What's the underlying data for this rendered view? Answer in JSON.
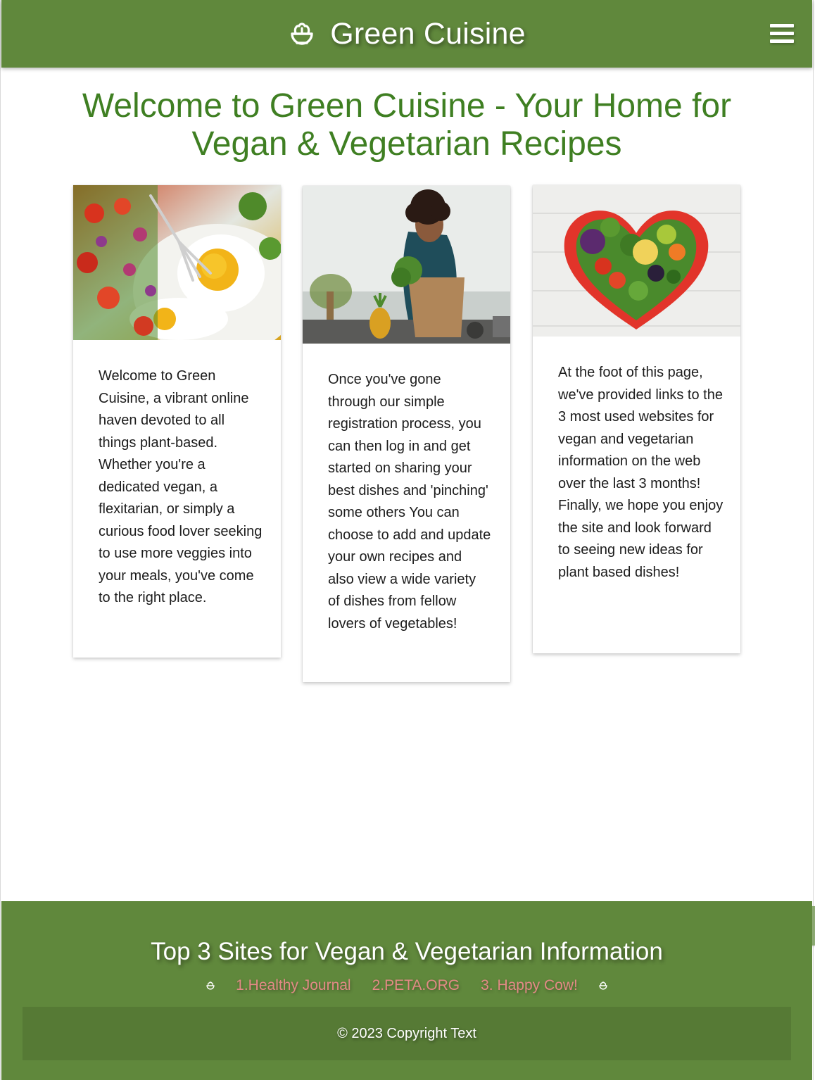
{
  "header": {
    "brand_text": "Green Cuisine",
    "brand_icon": "salad-bowl-icon",
    "menu_icon": "hamburger-menu-icon",
    "background_color": "#60883c"
  },
  "main": {
    "title": "Welcome to Green Cuisine - Your Home for Vegan & Vegetarian Recipes",
    "title_color": "#3f7f22",
    "cards": [
      {
        "image": "vegetables-and-eggs-photo",
        "text": "Welcome to Green Cuisine, a vibrant online haven devoted to all things plant-based. Whether you're a dedicated vegan, a flexitarian, or simply a curious food lover seeking to use more veggies into your meals, you've come to the right place."
      },
      {
        "image": "woman-unpacking-groceries-photo",
        "text": "Once you've gone through our simple registration process, you can then log in and get started on sharing your best dishes and 'pinching' some others You can choose to add and update your own recipes and also view a wide variety of dishes from fellow lovers of vegetables!"
      },
      {
        "image": "heart-shaped-vegetable-plate-photo",
        "text_lines": [
          "At the foot of this page, we've provided links to the 3 most used websites for vegan and vegetarian information on the web over the last 3 months!",
          "Finally, we hope you enjoy the site and look forward to seeing new ideas for plant based dishes!"
        ]
      }
    ]
  },
  "footer": {
    "title": "Top 3 Sites for Vegan & Vegetarian Information",
    "links": [
      "1.Healthy Journal",
      "2.PETA.ORG",
      "3. Happy Cow!"
    ],
    "link_color": "#e28a86",
    "copyright": "© 2023 Copyright Text",
    "background_color": "#60883c"
  },
  "side_widget": {
    "glyph": ">_<"
  }
}
